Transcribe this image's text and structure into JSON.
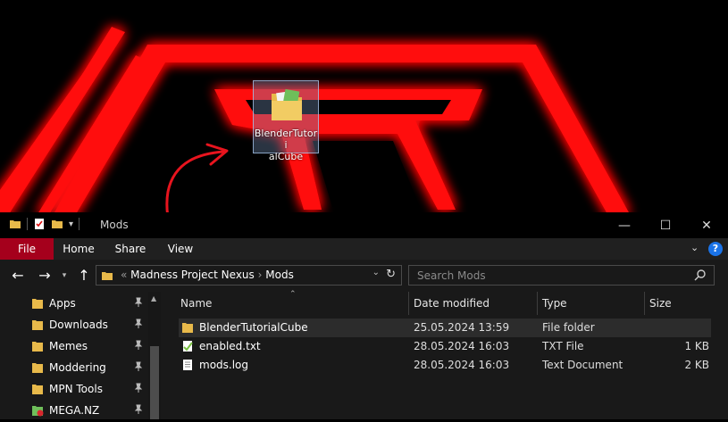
{
  "desktop": {
    "icon_label": "BlenderTutorialCube",
    "icon_label_lines": [
      "BlenderTutori",
      "alCube"
    ]
  },
  "explorer": {
    "window_title": "Mods",
    "title_separator": "|",
    "ribbon_tabs": [
      "File",
      "Home",
      "Share",
      "View"
    ],
    "breadcrumb_prefix": "«",
    "breadcrumbs": [
      "Madness Project Nexus",
      "Mods"
    ],
    "breadcrumb_separator": "›",
    "search_placeholder": "Search Mods",
    "sidebar": [
      {
        "label": "Apps",
        "pinned": true
      },
      {
        "label": "Downloads",
        "pinned": true
      },
      {
        "label": "Memes",
        "pinned": true
      },
      {
        "label": "Moddering",
        "pinned": true
      },
      {
        "label": "MPN Tools",
        "pinned": true
      },
      {
        "label": "MEGA.NZ",
        "pinned": true
      }
    ],
    "columns": [
      "Name",
      "Date modified",
      "Type",
      "Size"
    ],
    "files": [
      {
        "name": "BlenderTutorialCube",
        "date": "25.05.2024 13:59",
        "type": "File folder",
        "size": "",
        "icon": "folder-icon",
        "selected": true
      },
      {
        "name": "enabled.txt",
        "date": "28.05.2024 16:03",
        "type": "TXT File",
        "size": "1 KB",
        "icon": "txt-file-icon",
        "selected": false
      },
      {
        "name": "mods.log",
        "date": "28.05.2024 16:03",
        "type": "Text Document",
        "size": "2 KB",
        "icon": "log-file-icon",
        "selected": false
      }
    ]
  },
  "colors": {
    "wallpaper_red": "#ff1010",
    "file_tab": "#a5001c",
    "selection": "#2c2c2c"
  }
}
